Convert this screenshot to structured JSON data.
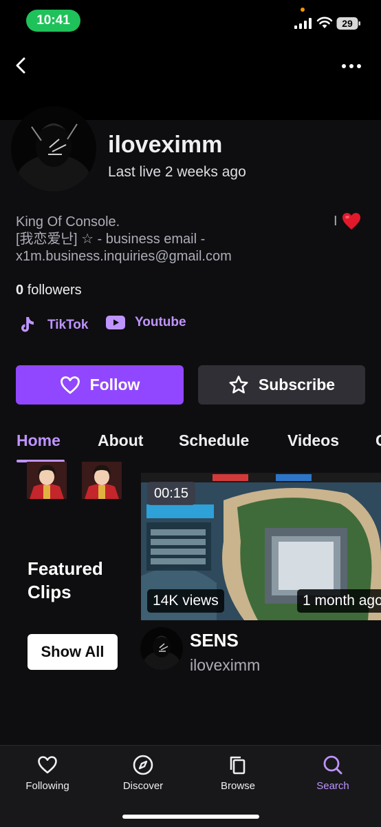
{
  "status_bar": {
    "time": "10:41",
    "battery": "29"
  },
  "channel": {
    "name": "iloveximm",
    "last_live": "Last live 2 weeks ago",
    "bio": "King Of Console.\n[我恋爱난] ☆ - business email -\nx1m.business.inquiries@gmail.com",
    "bio_right": "I",
    "followers_count": "0",
    "followers_label": "followers"
  },
  "socials": [
    {
      "label": "TikTok",
      "icon": "tiktok-icon"
    },
    {
      "label": "Youtube",
      "icon": "youtube-icon"
    }
  ],
  "actions": {
    "follow_label": "Follow",
    "subscribe_label": "Subscribe"
  },
  "tabs": [
    "Home",
    "About",
    "Schedule",
    "Videos",
    "C"
  ],
  "active_tab": "Home",
  "featured": {
    "title": "Featured\nClips",
    "show_all_label": "Show All",
    "clip": {
      "duration": "00:15",
      "views": "14K views",
      "age": "1 month ago",
      "title": "SENS",
      "channel": "iloveximm"
    }
  },
  "bottom_nav": [
    {
      "label": "Following",
      "icon": "heart-icon"
    },
    {
      "label": "Discover",
      "icon": "compass-icon"
    },
    {
      "label": "Browse",
      "icon": "browse-icon"
    },
    {
      "label": "Search",
      "icon": "search-icon",
      "active": true
    }
  ],
  "colors": {
    "accent": "#9147ff",
    "accent_text": "#bf94ff",
    "background": "#0e0e10"
  }
}
